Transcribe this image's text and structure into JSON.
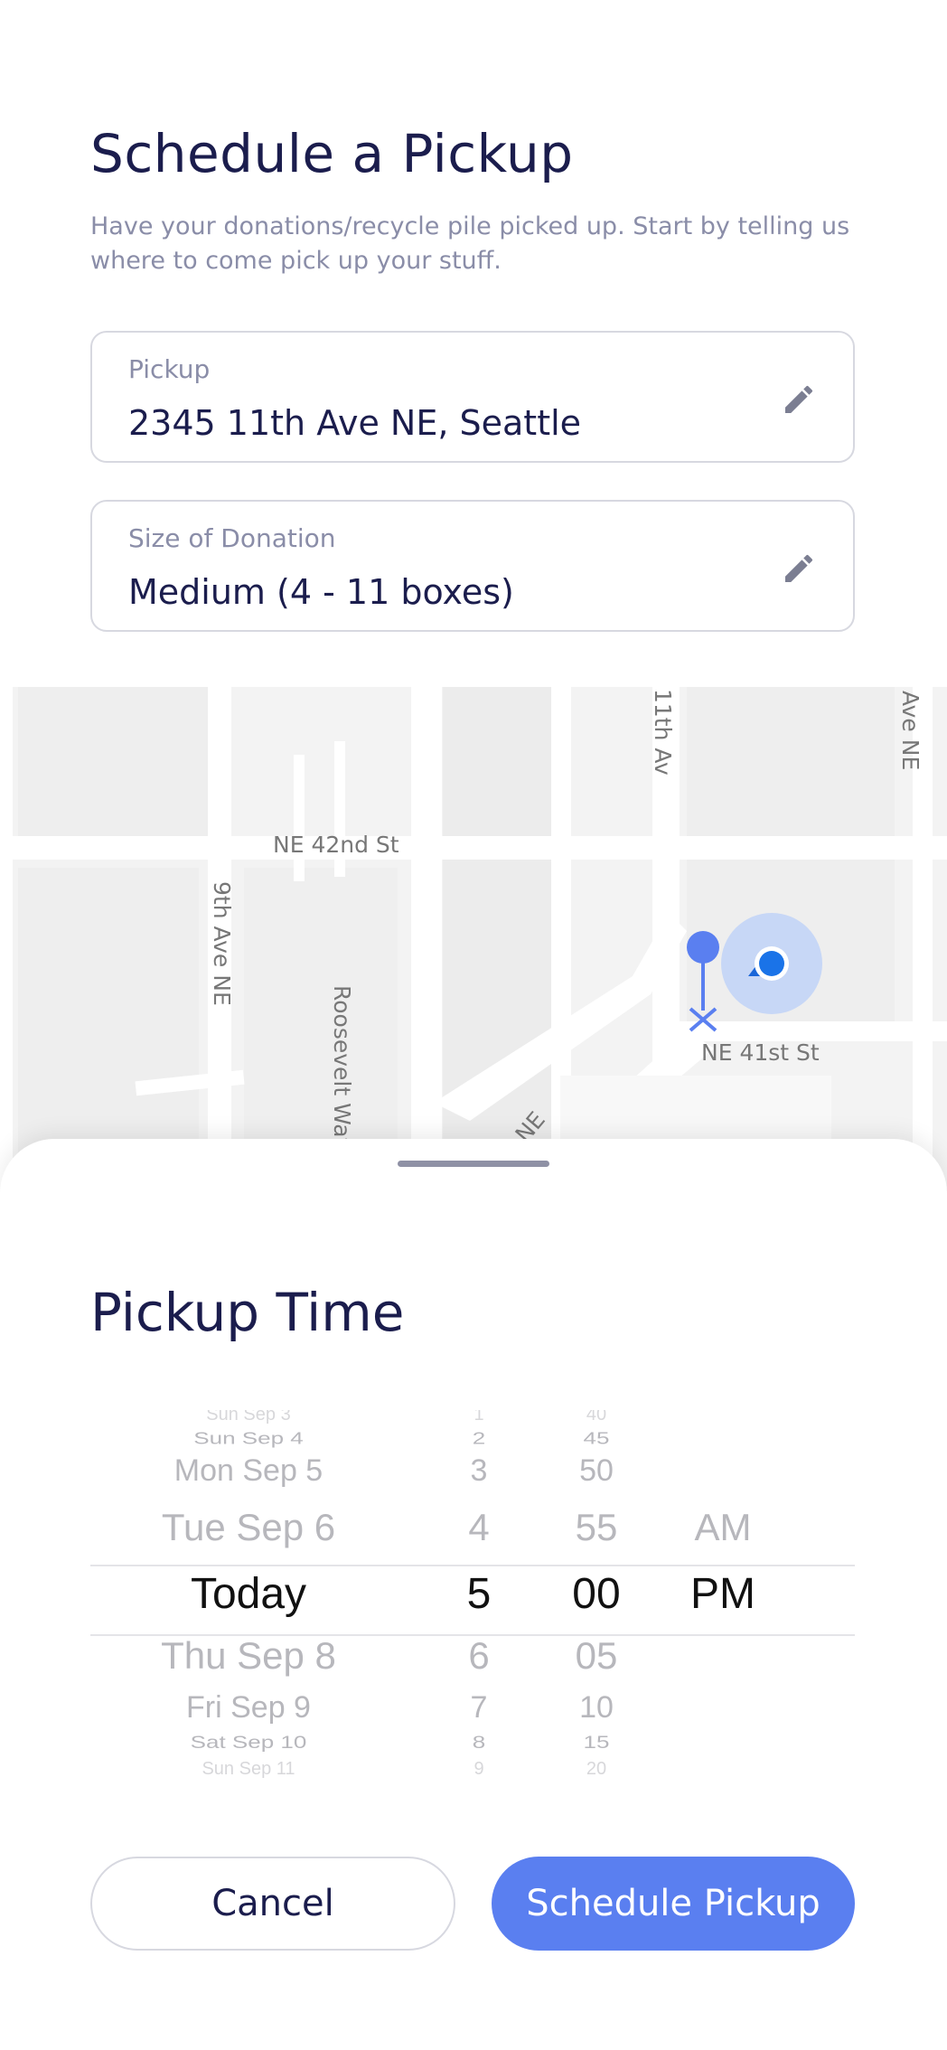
{
  "header": {
    "title": "Schedule a Pickup",
    "subtitle": "Have your donations/recycle pile picked up. Start by telling us where to come pick up your stuff."
  },
  "fields": {
    "pickup": {
      "label": "Pickup",
      "value": "2345 11th Ave NE, Seattle",
      "icon": "pencil-icon"
    },
    "size": {
      "label": "Size of Donation",
      "value": "Medium (4 - 11 boxes)",
      "icon": "pencil-icon"
    }
  },
  "map": {
    "streets": {
      "ne42": "NE 42nd St",
      "roosevelt": "Roosevelt Way NE",
      "eleventh": "11th Av",
      "avene_right": "Ave NE",
      "ninth": "9th Ave NE",
      "ne41": "NE 41st St",
      "diag": "ve NE"
    },
    "marker_color": "#5a7ff0",
    "location_color": "#1a73e8"
  },
  "sheet": {
    "title": "Pickup Time",
    "picker": {
      "days": [
        "Sun Sep 3",
        "Sun Sep 4",
        "Mon Sep 5",
        "Tue Sep 6",
        "Today",
        "Thu Sep 8",
        "Fri Sep 9",
        "Sat Sep 10",
        "Sun Sep 11"
      ],
      "hours": [
        "1",
        "2",
        "3",
        "4",
        "5",
        "6",
        "7",
        "8",
        "9"
      ],
      "minutes": [
        "40",
        "45",
        "50",
        "55",
        "00",
        "05",
        "10",
        "15",
        "20"
      ],
      "ampm": [
        "AM",
        "PM"
      ],
      "selected": {
        "day": "Today",
        "hour": "5",
        "minute": "00",
        "ampm": "PM"
      }
    }
  },
  "actions": {
    "cancel": "Cancel",
    "schedule": "Schedule Pickup"
  },
  "colors": {
    "primary": "#5a7ff0",
    "title": "#1b1d4d",
    "muted": "#8a8da8"
  }
}
